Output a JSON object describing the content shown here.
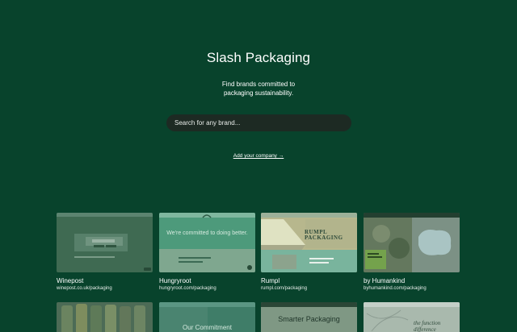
{
  "header": {
    "title": "Slash Packaging",
    "subtitle_line1": "Find brands committed to",
    "subtitle_line2": "packaging sustainability."
  },
  "search": {
    "placeholder": "Search for any brand..."
  },
  "add_company": {
    "label": "Add your company →"
  },
  "brands": [
    {
      "name": "Winepost",
      "url": "winepost.co.uk/packaging"
    },
    {
      "name": "Hungryroot",
      "url": "hungryroot.com/packaging",
      "thumb_text": "We're committed to doing better."
    },
    {
      "name": "Rumpl",
      "url": "rumpl.com/packaging",
      "thumb_text": "RUMPL PACKAGING"
    },
    {
      "name": "by Humankind",
      "url": "byhumankind.com/packaging"
    }
  ],
  "row2": [
    {
      "thumb_text": ""
    },
    {
      "thumb_text": "Our Commitment"
    },
    {
      "thumb_text": "Smarter Packaging"
    },
    {
      "thumb_text": "the function difference"
    }
  ],
  "colors": {
    "background": "#08432c",
    "search_bg": "#1d2a23"
  }
}
